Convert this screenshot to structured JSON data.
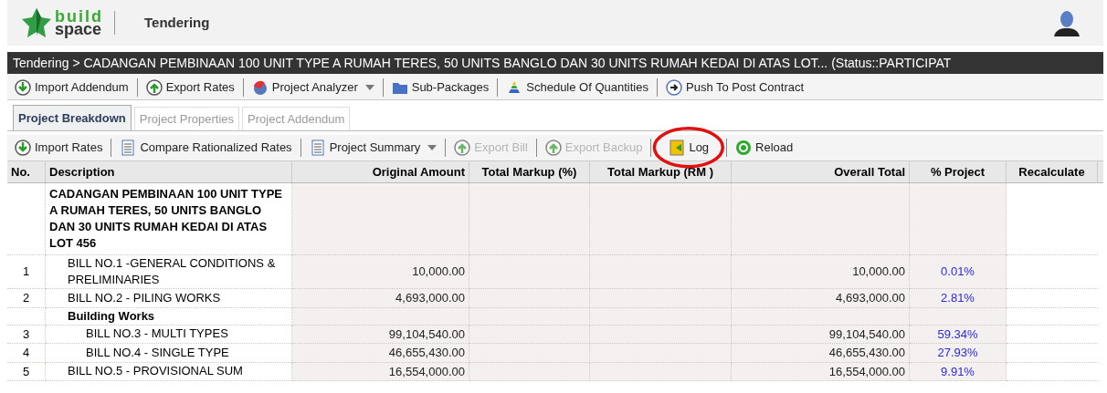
{
  "header": {
    "logo": [
      "build",
      "space"
    ],
    "module": "Tendering"
  },
  "breadcrumb": "Tendering > CADANGAN PEMBINAAN 100 UNIT TYPE A RUMAH TERES, 50 UNITS BANGLO DAN 30 UNITS RUMAH KEDAI DI ATAS LOT... (Status::PARTICIPAT",
  "main_toolbar": [
    {
      "label": "Import Addendum",
      "menu": false,
      "disabled": false
    },
    {
      "label": "Export Rates",
      "menu": false,
      "disabled": false
    },
    {
      "label": "Project Analyzer",
      "menu": true,
      "disabled": false
    },
    {
      "label": "Sub-Packages",
      "menu": false,
      "disabled": false
    },
    {
      "label": "Schedule Of Quantities",
      "menu": false,
      "disabled": false
    },
    {
      "label": "Push To Post Contract",
      "menu": false,
      "disabled": false
    }
  ],
  "tabs": [
    {
      "label": "Project Breakdown",
      "selected": true
    },
    {
      "label": "Project Properties",
      "selected": false
    },
    {
      "label": "Project Addendum",
      "selected": false
    }
  ],
  "toolbar": [
    {
      "label": "Import Rates",
      "menu": false,
      "disabled": false,
      "circled": false
    },
    {
      "label": "Compare Rationalized Rates",
      "menu": false,
      "disabled": false,
      "circled": false
    },
    {
      "label": "Project Summary",
      "menu": true,
      "disabled": false,
      "circled": false
    },
    {
      "label": "Export Bill",
      "menu": false,
      "disabled": true,
      "circled": false
    },
    {
      "label": "Export Backup",
      "menu": false,
      "disabled": true,
      "circled": false
    },
    {
      "label": "Log",
      "menu": false,
      "disabled": false,
      "circled": true
    },
    {
      "label": "Reload",
      "menu": false,
      "disabled": false,
      "circled": false
    }
  ],
  "table": {
    "columns": [
      "No.",
      "Description",
      "Original Amount",
      "Total Markup (%)",
      "Total Markup (RM )",
      "Overall Total",
      "% Project",
      "Recalculate"
    ],
    "rows": [
      {
        "kind": "project",
        "description": "CADANGAN PEMBINAAN 100 UNIT TYPE A RUMAH TERES, 50 UNITS BANGLO DAN 30 UNITS RUMAH KEDAI DI ATAS LOT 456",
        "children": [
          {
            "kind": "bill",
            "no": "1",
            "description": "BILL NO.1 -GENERAL CONDITIONS & PRELIMINARIES",
            "original_amount": "10,000.00",
            "overall_total": "10,000.00",
            "percent_project": "0.01%"
          },
          {
            "kind": "bill",
            "no": "2",
            "description": "BILL NO.2 - PILING WORKS",
            "original_amount": "4,693,000.00",
            "overall_total": "4,693,000.00",
            "percent_project": "2.81%"
          },
          {
            "kind": "group",
            "description": "Building Works",
            "children": [
              {
                "kind": "bill",
                "no": "3",
                "description": "BILL NO.3 - MULTI TYPES",
                "original_amount": "99,104,540.00",
                "overall_total": "99,104,540.00",
                "percent_project": "59.34%"
              },
              {
                "kind": "bill",
                "no": "4",
                "description": "BILL NO.4 - SINGLE TYPE",
                "original_amount": "46,655,430.00",
                "overall_total": "46,655,430.00",
                "percent_project": "27.93%"
              }
            ]
          },
          {
            "kind": "bill",
            "no": "5",
            "description": "BILL NO.5 - PROVISIONAL SUM",
            "original_amount": "16,554,000.00",
            "overall_total": "16,554,000.00",
            "percent_project": "9.91%"
          }
        ]
      }
    ]
  }
}
